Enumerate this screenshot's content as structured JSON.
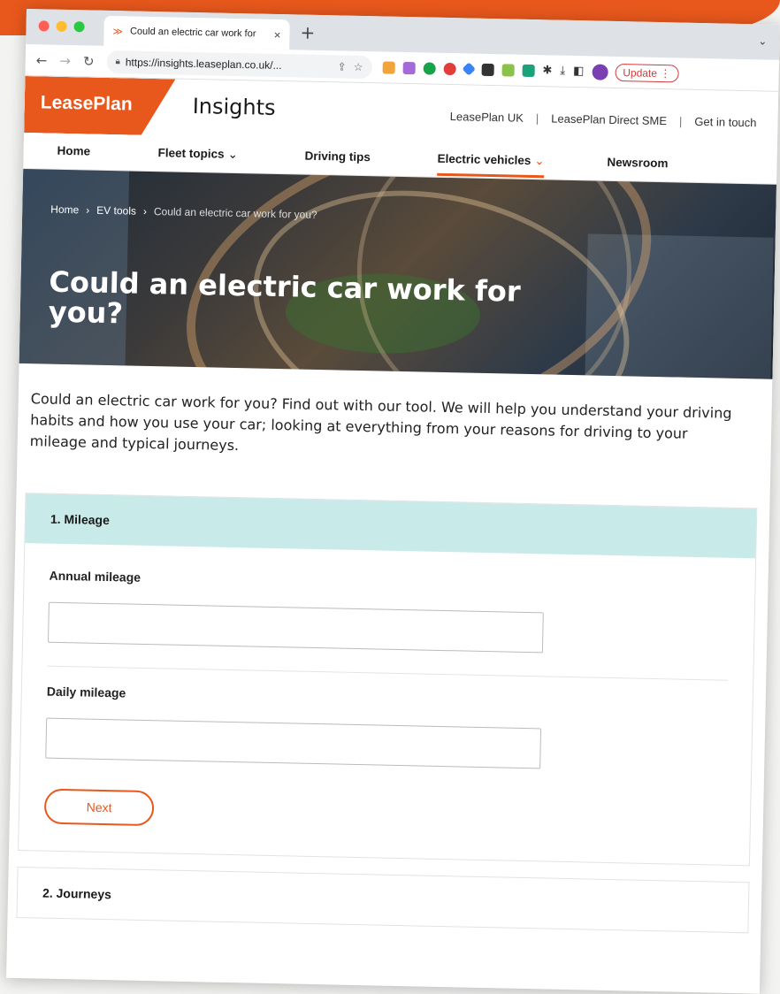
{
  "browser": {
    "tab_title": "Could an electric car work for",
    "tab_close": "×",
    "new_tab": "+",
    "url": "https://insights.leaseplan.co.uk/...",
    "update_label": "Update"
  },
  "site": {
    "logo": "LeasePlan",
    "brand_sub": "Insights",
    "top_links": [
      "LeasePlan UK",
      "LeasePlan Direct SME",
      "Get in touch"
    ],
    "nav": [
      "Home",
      "Fleet topics",
      "Driving tips",
      "Electric vehicles",
      "Newsroom"
    ],
    "accent": "#e8581c"
  },
  "hero": {
    "breadcrumb": [
      "Home",
      "EV tools",
      "Could an electric car work for you?"
    ],
    "title": "Could an electric car work for you?"
  },
  "intro": "Could an electric car work for you? Find out with our tool. We will help you understand your driving habits and how you use your car; looking at everything from your reasons for driving to your mileage and typical journeys.",
  "form": {
    "section1_title": "1. Mileage",
    "annual_label": "Annual mileage",
    "daily_label": "Daily mileage",
    "next_label": "Next",
    "section2_title": "2. Journeys"
  }
}
